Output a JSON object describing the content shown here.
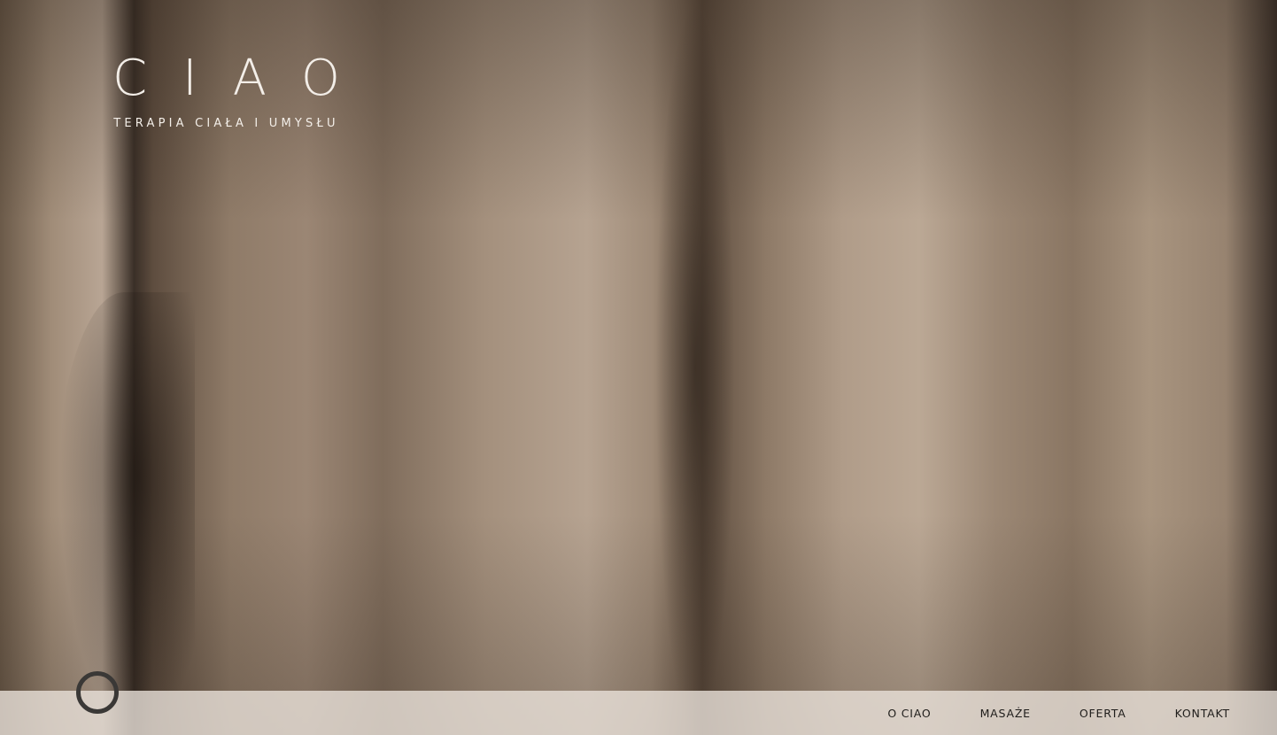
{
  "brand": {
    "name": "CIAO",
    "tagline": "TERAPIA CIAŁA I UMYSŁU",
    "text_color": "#f3eee8"
  },
  "hero": {
    "image": "bare-back-photo"
  },
  "navbar": {
    "background": "#ece4dc",
    "logo_icon": "ring-icon",
    "links": [
      {
        "label": "O CIAO"
      },
      {
        "label": "MASAŻE"
      },
      {
        "label": "OFERTA"
      },
      {
        "label": "KONTAKT"
      }
    ]
  }
}
